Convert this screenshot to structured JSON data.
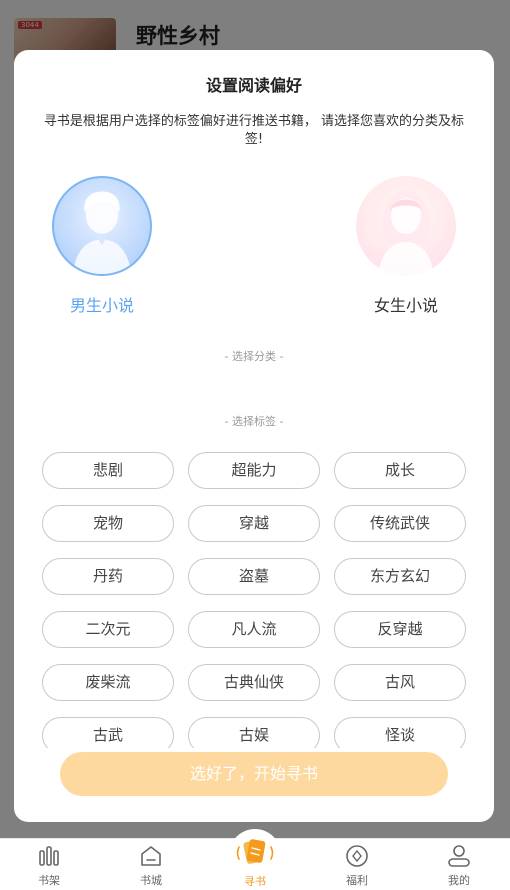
{
  "background": {
    "book_title": "野性乡村",
    "cover_badge": "3044"
  },
  "modal": {
    "title": "设置阅读偏好",
    "description": "寻书是根据用户选择的标签偏好进行推送书籍， 请选择您喜欢的分类及标签!",
    "genders": [
      {
        "label": "男生小说",
        "selected": true
      },
      {
        "label": "女生小说",
        "selected": false
      }
    ],
    "category_section_label": "- 选择分类 -",
    "tag_section_label": "- 选择标签 -",
    "tags": [
      "悲剧",
      "超能力",
      "成长",
      "宠物",
      "穿越",
      "传统武侠",
      "丹药",
      "盗墓",
      "东方玄幻",
      "二次元",
      "凡人流",
      "反穿越",
      "废柴流",
      "古典仙侠",
      "古风",
      "古武",
      "古娱",
      "怪谈"
    ],
    "start_button": "选好了，开始寻书"
  },
  "tabbar": {
    "items": [
      {
        "label": "书架",
        "icon": "bookshelf-icon"
      },
      {
        "label": "书城",
        "icon": "bookstore-icon"
      },
      {
        "label": "寻书",
        "icon": "find-book-icon",
        "active": true
      },
      {
        "label": "福利",
        "icon": "welfare-icon"
      },
      {
        "label": "我的",
        "icon": "profile-icon"
      }
    ]
  },
  "colors": {
    "accent_orange": "#f49a1c",
    "button_bg": "#fdd9a0",
    "male_blue": "#5aa3ee"
  }
}
